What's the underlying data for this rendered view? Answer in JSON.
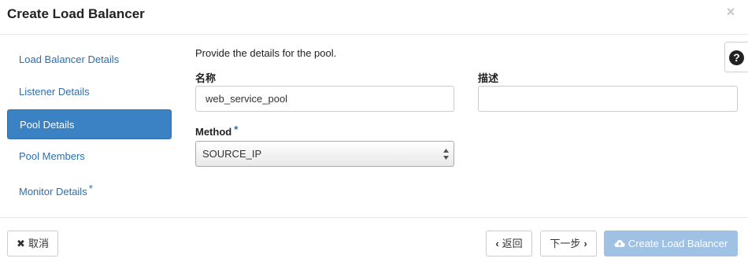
{
  "header": {
    "title": "Create Load Balancer",
    "close_label": "×"
  },
  "steps": [
    {
      "label": "Load Balancer Details",
      "required": false,
      "active": false
    },
    {
      "label": "Listener Details",
      "required": false,
      "active": false
    },
    {
      "label": "Pool Details",
      "required": false,
      "active": true
    },
    {
      "label": "Pool Members",
      "required": false,
      "active": false
    },
    {
      "label": "Monitor Details",
      "required": true,
      "active": false
    }
  ],
  "required_marker": "*",
  "help": {
    "label": "?"
  },
  "form": {
    "intro": "Provide the details for the pool.",
    "name_label": "名称",
    "name_value": "web_service_pool",
    "description_label": "描述",
    "description_value": "",
    "method_label": "Method",
    "method_value": "SOURCE_IP"
  },
  "footer": {
    "cancel_label": "取消",
    "back_label": "返回",
    "next_label": "下一步",
    "create_label": "Create Load Balancer"
  },
  "colors": {
    "accent": "#3b82c4",
    "link": "#2a6fb0",
    "primary_disabled": "#9fc1e3"
  }
}
